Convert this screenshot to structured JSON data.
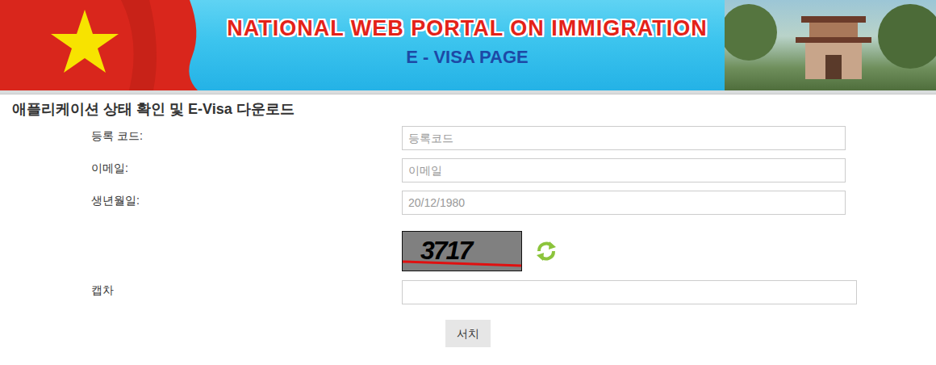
{
  "header": {
    "title": "NATIONAL WEB PORTAL ON IMMIGRATION",
    "subtitle": "E - VISA PAGE"
  },
  "form": {
    "heading": "애플리케이션 상태 확인 및 E-Visa 다운로드",
    "fields": [
      {
        "label": "등록 코드:",
        "placeholder": "등록코드"
      },
      {
        "label": "이메일:",
        "placeholder": "이메일"
      },
      {
        "label": "생년월일:",
        "placeholder": "20/12/1980"
      }
    ]
  },
  "captcha": {
    "code": "3717",
    "label": "캡차"
  },
  "buttons": [
    "서치"
  ]
}
